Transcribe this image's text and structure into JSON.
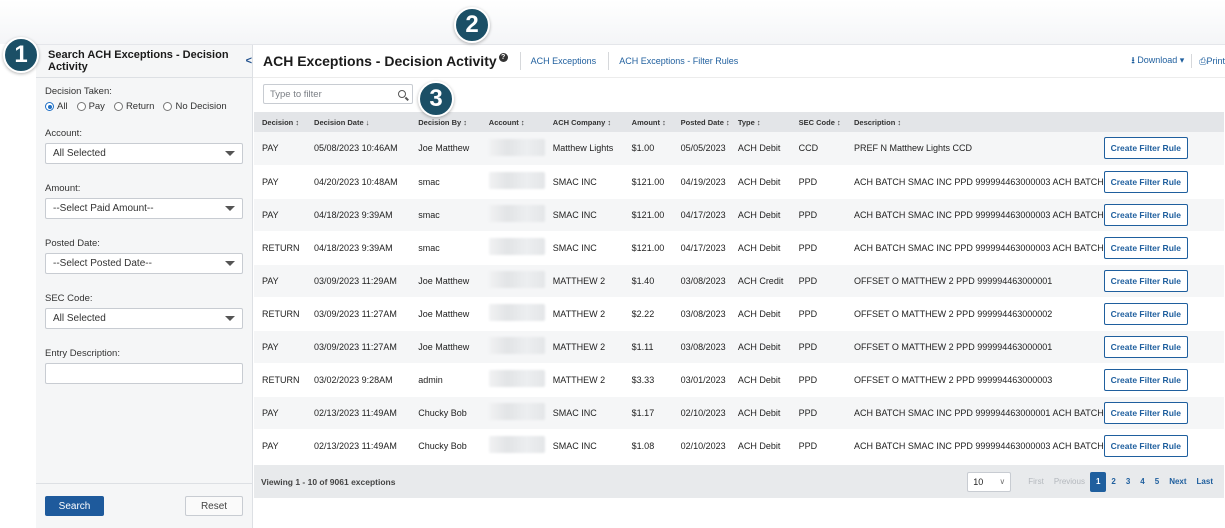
{
  "badges": [
    "1",
    "2",
    "3"
  ],
  "sidebar": {
    "title": "Search ACH Exceptions - Decision Activity",
    "collapse_glyph": "<",
    "decision_label": "Decision Taken:",
    "decision_options": [
      {
        "label": "All",
        "selected": true
      },
      {
        "label": "Pay",
        "selected": false
      },
      {
        "label": "Return",
        "selected": false
      },
      {
        "label": "No Decision",
        "selected": false
      }
    ],
    "account_label": "Account:",
    "account_value": "All Selected",
    "amount_label": "Amount:",
    "amount_value": "--Select Paid Amount--",
    "posted_label": "Posted Date:",
    "posted_value": "--Select Posted Date--",
    "sec_label": "SEC Code:",
    "sec_value": "All Selected",
    "entry_label": "Entry Description:",
    "entry_value": "",
    "search_btn": "Search",
    "reset_btn": "Reset"
  },
  "header": {
    "title": "ACH Exceptions - Decision Activity",
    "help_glyph": "?",
    "links": [
      "ACH Exceptions",
      "ACH Exceptions - Filter Rules"
    ],
    "download": "Download",
    "print": "Print"
  },
  "filter": {
    "placeholder": "Type to filter"
  },
  "table": {
    "columns": [
      "Decision ↕",
      "Decision Date ↓",
      "Decision By ↕",
      "Account ↕",
      "ACH Company ↕",
      "Amount ↕",
      "Posted Date ↕",
      "Type ↕",
      "SEC Code ↕",
      "Description ↕"
    ],
    "action_label": "Create Filter Rule",
    "rows": [
      [
        "PAY",
        "05/08/2023 10:46AM",
        "Joe Matthew",
        "",
        "Matthew Lights",
        "$1.00",
        "05/05/2023",
        "ACH Debit",
        "CCD",
        "PREF N Matthew Lights CCD"
      ],
      [
        "PAY",
        "04/20/2023 10:48AM",
        "smac",
        "",
        "SMAC INC",
        "$121.00",
        "04/19/2023",
        "ACH Debit",
        "PPD",
        "ACH BATCH SMAC INC PPD 999994463000003 ACH BATCH"
      ],
      [
        "PAY",
        "04/18/2023 9:39AM",
        "smac",
        "",
        "SMAC INC",
        "$121.00",
        "04/17/2023",
        "ACH Debit",
        "PPD",
        "ACH BATCH SMAC INC PPD 999994463000003 ACH BATCH"
      ],
      [
        "RETURN",
        "04/18/2023 9:39AM",
        "smac",
        "",
        "SMAC INC",
        "$121.00",
        "04/17/2023",
        "ACH Debit",
        "PPD",
        "ACH BATCH SMAC INC PPD 999994463000003 ACH BATCH"
      ],
      [
        "PAY",
        "03/09/2023 11:29AM",
        "Joe Matthew",
        "",
        "MATTHEW 2",
        "$1.40",
        "03/08/2023",
        "ACH Credit",
        "PPD",
        "OFFSET O MATTHEW 2 PPD 999994463000001"
      ],
      [
        "RETURN",
        "03/09/2023 11:27AM",
        "Joe Matthew",
        "",
        "MATTHEW 2",
        "$2.22",
        "03/08/2023",
        "ACH Debit",
        "PPD",
        "OFFSET O MATTHEW 2 PPD 999994463000002"
      ],
      [
        "PAY",
        "03/09/2023 11:27AM",
        "Joe Matthew",
        "",
        "MATTHEW 2",
        "$1.11",
        "03/08/2023",
        "ACH Debit",
        "PPD",
        "OFFSET O MATTHEW 2 PPD 999994463000001"
      ],
      [
        "RETURN",
        "03/02/2023 9:28AM",
        "admin",
        "",
        "MATTHEW 2",
        "$3.33",
        "03/01/2023",
        "ACH Debit",
        "PPD",
        "OFFSET O MATTHEW 2 PPD 999994463000003"
      ],
      [
        "PAY",
        "02/13/2023 11:49AM",
        "Chucky Bob",
        "",
        "SMAC INC",
        "$1.17",
        "02/10/2023",
        "ACH Debit",
        "PPD",
        "ACH BATCH SMAC INC PPD 999994463000001 ACH BATCH"
      ],
      [
        "PAY",
        "02/13/2023 11:49AM",
        "Chucky Bob",
        "",
        "SMAC INC",
        "$1.08",
        "02/10/2023",
        "ACH Debit",
        "PPD",
        "ACH BATCH SMAC INC PPD 999994463000003 ACH BATCH"
      ]
    ]
  },
  "footer": {
    "viewing": "Viewing 1 - 10 of 9061 exceptions",
    "page_size": "10",
    "first": "First",
    "previous": "Previous",
    "pages": [
      "1",
      "2",
      "3",
      "4",
      "5"
    ],
    "active_page": "1",
    "next": "Next",
    "last": "Last"
  }
}
